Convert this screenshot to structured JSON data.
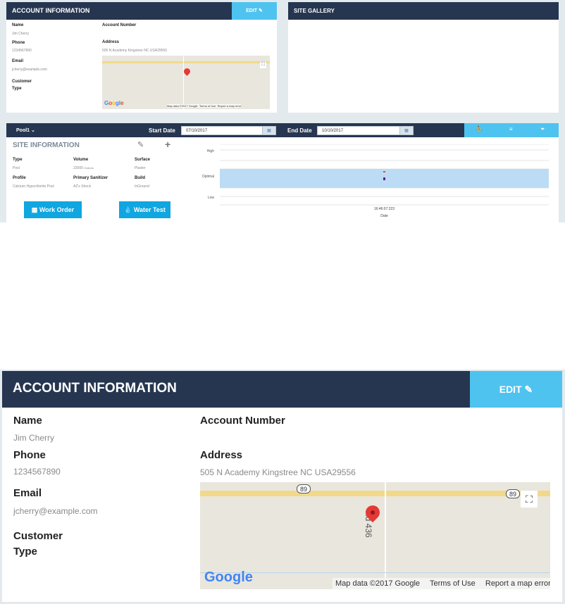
{
  "account": {
    "title": "ACCOUNT INFORMATION",
    "edit_label": "EDIT",
    "name_label": "Name",
    "name_value": "Jim Cherry",
    "phone_label": "Phone",
    "phone_value": "1234567890",
    "email_label": "Email",
    "email_value": "jcherry@example.com",
    "customer_type_label_1": "Customer",
    "customer_type_label_2": "Type",
    "account_number_label": "Account Number",
    "address_label": "Address",
    "address_value": "505 N Academy Kingstree NC USA29556"
  },
  "map": {
    "route_badge": "89",
    "road_label": "Rd 436",
    "attribution": "Map data ©2017 Google",
    "terms": "Terms of Use",
    "report": "Report a map error",
    "logo": "Google"
  },
  "gallery": {
    "title": "SITE GALLERY"
  },
  "toolbar": {
    "pool_select": "Pool1",
    "start_label": "Start Date",
    "start_value": "07/10/2017",
    "end_label": "End Date",
    "end_value": "10/10/2017"
  },
  "site_info": {
    "title": "SITE INFORMATION",
    "type_label": "Type",
    "type_value": "Pool",
    "volume_label": "Volume",
    "volume_value": "22000",
    "volume_unit": "Gallons",
    "surface_label": "Surface",
    "surface_value": "Plaster",
    "profile_label": "Profile",
    "profile_value": "Calcium Hypochlorite Pool",
    "sanitizer_label": "Primary Sanitizer",
    "sanitizer_value": "AZ's Shock",
    "build_label": "Build",
    "build_value": "InGround",
    "work_order_label": "Work Order",
    "water_test_label": "Water Test"
  },
  "chart_data": {
    "type": "scatter",
    "y_categories": [
      "High",
      "Optimal",
      "Low"
    ],
    "x_tick_labels": [
      "16:46:07.223"
    ],
    "xlabel": "Date",
    "series": [
      {
        "color": "#e74c3c",
        "x": [
          "16:46:07.223"
        ],
        "y": [
          "Optimal"
        ]
      },
      {
        "color": "#6a1b9a",
        "x": [
          "16:46:07.223"
        ],
        "y": [
          "Optimal"
        ]
      }
    ],
    "optimal_band_color": "#bcdcf5"
  }
}
